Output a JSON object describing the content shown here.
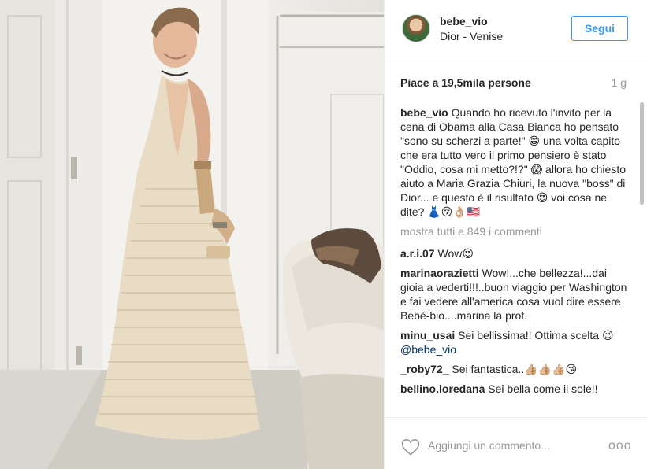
{
  "post": {
    "username": "bebe_vio",
    "location": "Dior - Venise",
    "follow_label": "Segui",
    "likes": "Piace a 19,5mila persone",
    "time_ago": "1 g"
  },
  "caption": {
    "user": "bebe_vio",
    "text": "Quando ho ricevuto l'invito per la cena di Obama alla Casa Bianca ho pensato \"sono su scherzi a parte!\" 😁 una volta capito che era tutto vero il primo pensiero è stato \"Oddio, cosa mi metto?!?\" 😱 allora ho chiesto aiuto a Maria Grazia Chiuri, la nuova \"boss\" di Dior... e questo è il risultato 😍 voi cosa ne dite? 👗😚👌🏼🇺🇸"
  },
  "show_all": "mostra tutti e 849 i commenti",
  "comments": [
    {
      "user": "a.r.i.07",
      "text": "Wow😍"
    },
    {
      "user": "marinaorazietti",
      "text": "Wow!...che bellezza!...dai gioia a vederti!!!..buon viaggio per Washington e fai vedere all'america cosa vuol dire essere Bebè-bio....marina la prof."
    },
    {
      "user": "minu_usai",
      "text": "Sei bellissima!! Ottima scelta 😉",
      "mention": "@bebe_vio"
    },
    {
      "user": "_roby72_",
      "text": "Sei fantastica..👍🏼👍🏼👍🏼😘"
    },
    {
      "user": "bellino.loredana",
      "text": "Sei bella come il sole!!"
    }
  ],
  "footer": {
    "comment_placeholder": "Aggiungi un commento...",
    "more_label": "ooo"
  },
  "icons": {
    "heart": "heart-icon",
    "more": "more-options-icon"
  },
  "colors": {
    "accent": "#3897f0",
    "text": "#262626",
    "muted": "#999999",
    "border": "#efefef"
  }
}
